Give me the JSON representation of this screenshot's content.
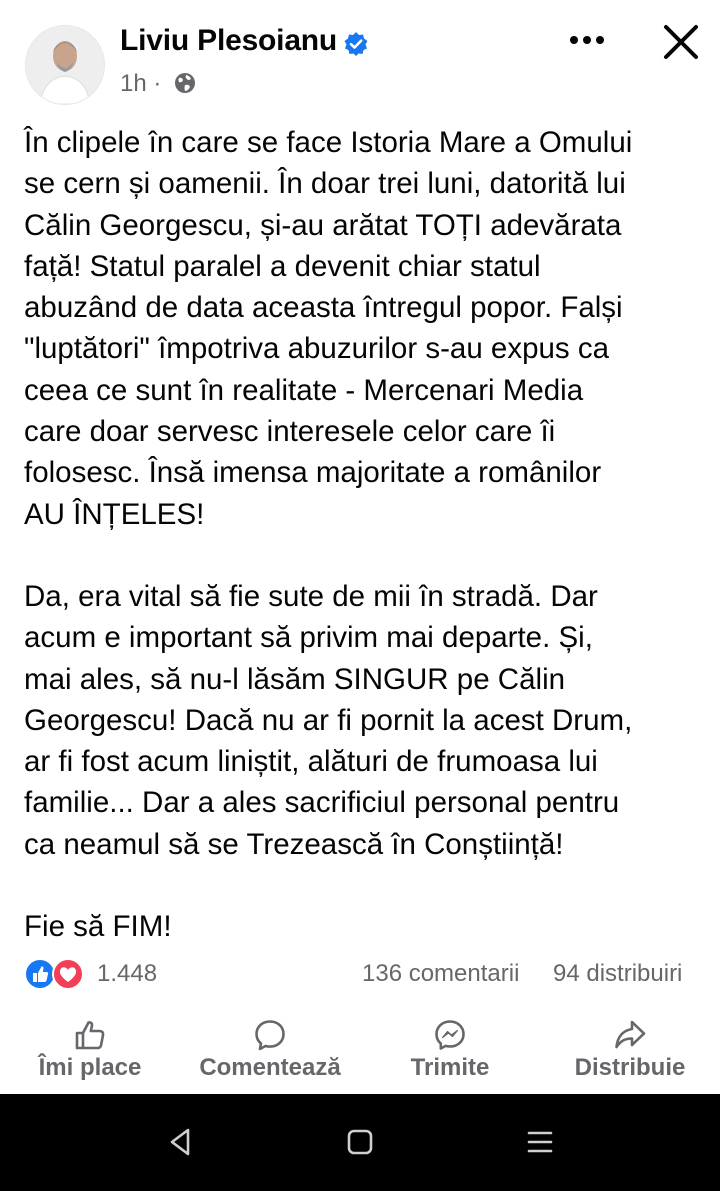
{
  "post": {
    "author": "Liviu Plesoianu",
    "time": "1h",
    "separator": "·",
    "paragraphs": [
      "În clipele în care se face Istoria Mare a Omului\nse cern și oamenii. În doar trei luni, datorită lui\nCălin Georgescu, și-au arătat TOȚI adevărata\nfață! Statul paralel a devenit chiar statul\nabuzând de data aceasta întregul popor. Falși\n\"luptători\" împotriva abuzurilor s-au expus ca\nceea ce sunt în realitate - Mercenari Media\ncare doar servesc interesele celor care îi\nfolosesc. Însă imensa majoritate a românilor\nAU ÎNȚELES!",
      "Da, era vital să fie sute de mii în stradă. Dar\nacum e important să privim mai departe. Și,\nmai ales, să nu-l lăsăm SINGUR pe Călin\nGeorgescu! Dacă nu ar fi pornit la acest Drum,\nar fi fost acum liniștit, alături de frumoasa lui\nfamilie... Dar a ales sacrificiul personal pentru\nca neamul să se Trezească în Conștiință!",
      "Fie să FIM!"
    ]
  },
  "stats": {
    "reactions": "1.448",
    "comments": "136 comentarii",
    "shares": "94 distribuiri"
  },
  "actions": {
    "like": "Îmi place",
    "comment": "Comentează",
    "send": "Trimite",
    "share": "Distribuie"
  },
  "colors": {
    "text": "#050505",
    "secondary": "#65676b",
    "like_blue": "#1877f2",
    "love_red": "#f33e58",
    "navbar": "#000000"
  },
  "icons": [
    "verified-badge-icon",
    "globe-icon",
    "more-icon",
    "close-icon",
    "like-reaction-icon",
    "love-reaction-icon",
    "thumbs-up-icon",
    "comment-bubble-icon",
    "messenger-icon",
    "share-arrow-icon",
    "nav-back-icon",
    "nav-home-icon",
    "nav-menu-icon"
  ]
}
